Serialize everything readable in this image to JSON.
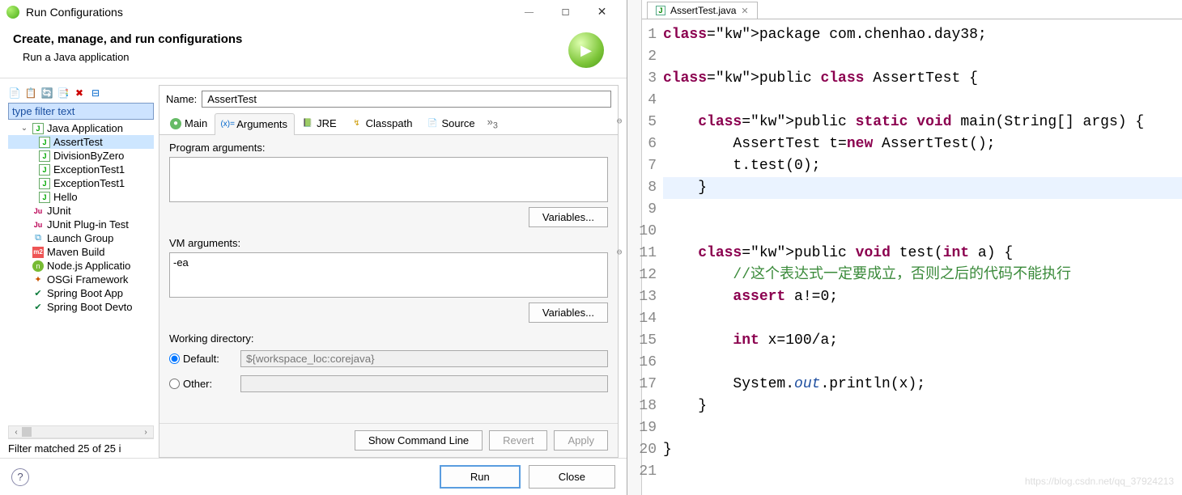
{
  "dialog": {
    "title": "Run Configurations",
    "heading": "Create, manage, and run configurations",
    "subheading": "Run a Java application",
    "filter_placeholder": "type filter text",
    "tree": {
      "java_app": "Java Application",
      "items": [
        "AssertTest",
        "DivisionByZero",
        "ExceptionTest1",
        "ExceptionTest1",
        "Hello"
      ],
      "others": [
        "JUnit",
        "JUnit Plug-in Test",
        "Launch Group",
        "Maven Build",
        "Node.js Applicatio",
        "OSGi Framework",
        "Spring Boot App",
        "Spring Boot Devto"
      ]
    },
    "filter_status": "Filter matched 25 of 25 i",
    "name_label": "Name:",
    "name_value": "AssertTest",
    "tabs": [
      "Main",
      "Arguments",
      "JRE",
      "Classpath",
      "Source"
    ],
    "prog_args_label": "Program arguments:",
    "prog_args_value": "",
    "vm_args_label": "VM arguments:",
    "vm_args_value": "-ea",
    "variables_btn": "Variables...",
    "wd_label": "Working directory:",
    "wd_default": "Default:",
    "wd_other": "Other:",
    "wd_default_value": "${workspace_loc:corejava}",
    "show_cmd": "Show Command Line",
    "revert": "Revert",
    "apply": "Apply",
    "run": "Run",
    "close": "Close"
  },
  "editor": {
    "tab_name": "AssertTest.java",
    "lines": [
      {
        "n": 1,
        "t": "package com.chenhao.day38;"
      },
      {
        "n": 2,
        "t": ""
      },
      {
        "n": 3,
        "t": "public class AssertTest {"
      },
      {
        "n": 4,
        "t": ""
      },
      {
        "n": 5,
        "t": "    public static void main(String[] args) {",
        "mk": "⊖"
      },
      {
        "n": 6,
        "t": "        AssertTest t=new AssertTest();"
      },
      {
        "n": 7,
        "t": "        t.test(0);"
      },
      {
        "n": 8,
        "t": "    }",
        "hl": true
      },
      {
        "n": 9,
        "t": ""
      },
      {
        "n": 10,
        "t": ""
      },
      {
        "n": 11,
        "t": "    public void test(int a) {",
        "mk": "⊖"
      },
      {
        "n": 12,
        "t": "        //这个表达式一定要成立，否则之后的代码不能执行"
      },
      {
        "n": 13,
        "t": "        assert a!=0;"
      },
      {
        "n": 14,
        "t": ""
      },
      {
        "n": 15,
        "t": "        int x=100/a;"
      },
      {
        "n": 16,
        "t": ""
      },
      {
        "n": 17,
        "t": "        System.out.println(x);"
      },
      {
        "n": 18,
        "t": "    }"
      },
      {
        "n": 19,
        "t": ""
      },
      {
        "n": 20,
        "t": "}"
      },
      {
        "n": 21,
        "t": ""
      }
    ],
    "watermark": "https://blog.csdn.net/qq_37924213"
  }
}
